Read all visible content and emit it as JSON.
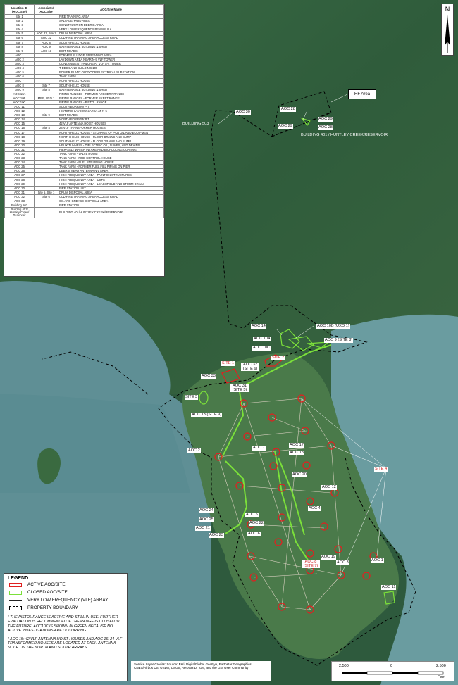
{
  "table": {
    "headers": [
      "Location ID (AOC/Site)",
      "Associated AOC/Site",
      "AOC/Site Name"
    ],
    "rows": [
      [
        "Site 1",
        "",
        "FIRE TRAINING AREA"
      ],
      [
        "Site 2",
        "",
        "SALVAGE YARD AREA"
      ],
      [
        "Site 3",
        "",
        "CONSTRUCTION DEBRIS AREA"
      ],
      [
        "Site 4",
        "",
        "VERY LOW FREQUENCY PENINSULA"
      ],
      [
        "Site 5",
        "AOC 31, Site 1",
        "DRUM DISPOSAL AREA"
      ],
      [
        "Site 6",
        "AOC 32",
        "OLD FIRE TRAINING AREA ACCESS ROAD"
      ],
      [
        "Site 7",
        "AOC 8",
        "SOUTH HELIX HOUSE"
      ],
      [
        "Site 8",
        "AOC 9",
        "MAINTENANCE BUILDING & SHED"
      ],
      [
        "Site 9",
        "AOC 13",
        "DIRT ROADS"
      ],
      [
        "AOC 1",
        "",
        "FORMER SLUDGE SPREADING AREA"
      ],
      [
        "AOC 2",
        "",
        "LAYDOWN AREA NEAR N-9 VLF TOWER"
      ],
      [
        "AOC 3",
        "",
        "CONTAINMENT FAILURE AT VLF S-4 TOWER"
      ],
      [
        "AOC 4",
        "",
        "T-DECK AND BUILDING 100"
      ],
      [
        "AOC 5",
        "",
        "POWER PLANT OUTDOOR ELECTRICAL SUBSTATION"
      ],
      [
        "AOC 6",
        "",
        "TANK FARM"
      ],
      [
        "AOC 7",
        "",
        "NORTH HELIX HOUSE"
      ],
      [
        "AOC 8",
        "Site 7",
        "SOUTH HELIX HOUSE"
      ],
      [
        "AOC 9",
        "Site 8",
        "MAINTENANCE BUILDING & SHED"
      ],
      [
        "AOC 10A",
        "",
        "FIRING RANGES - FORMER ARCHERY RANGE"
      ],
      [
        "AOC 10B",
        "MRP, UXO 1",
        "FIRING RANGES - FORMER SKEET RANGE"
      ],
      [
        "AOC 10C",
        "",
        "FIRING RANGES - PISTOL RANGE"
      ],
      [
        "AOC 11",
        "",
        "SOUTH BORROW PIT"
      ],
      [
        "AOC 12",
        "",
        "HISTORIC LAYDOWN AREA AT N-5"
      ],
      [
        "AOC 13",
        "Site 9",
        "DIRT ROADS"
      ],
      [
        "AOC 14",
        "",
        "NORTH BORROW PIT"
      ],
      [
        "AOC 15",
        "",
        "42 VLF ANTENNA HOIST HOUSES"
      ],
      [
        "AOC 16",
        "Site 4",
        "24 VLF TRANSFORMER HOUSES"
      ],
      [
        "AOC 17",
        "",
        "NORTH HELIX HOUSE - STORAGE OF PCB OIL AND EQUIPMENT"
      ],
      [
        "AOC 18",
        "",
        "NORTH HELIX HOUSE - FLOOR DRAINS AND SUMP"
      ],
      [
        "AOC 19",
        "",
        "SOUTH HELIX HOUSE - FLOOR DRAINS AND SUMP"
      ],
      [
        "AOC 20",
        "",
        "HELIX TUNNELS - DIELECTRIC OIL, SUMPS, AND DRAINS"
      ],
      [
        "AOC 21",
        "",
        "PIER-SALT WATER INTAKE AND BIOFOULING COATING"
      ],
      [
        "AOC 22",
        "",
        "TANK FARM - VALVE ROOM"
      ],
      [
        "AOC 23",
        "",
        "TANK FARM - FIRE CONTROL HOUSE"
      ],
      [
        "AOC 24",
        "",
        "TANK FARM - FUEL STRIPPING HOUSE"
      ],
      [
        "AOC 25",
        "",
        "TANK FARM - FORMER FUEL FILL PIPING ON PIER"
      ],
      [
        "AOC 26",
        "",
        "DEBRIS NEAR ANTENNA N-1 AREA"
      ],
      [
        "AOC 27",
        "",
        "HIGH FREQUENCY AREA - PAINT ON STRUCTURES"
      ],
      [
        "AOC 28",
        "",
        "HIGH FREQUENCY AREA - USTS"
      ],
      [
        "AOC 29",
        "",
        "HIGH FREQUENCY AREA - LEACHFIELD AND STORM DRAIN"
      ],
      [
        "AOC 30",
        "",
        "FIRE STATION UST"
      ],
      [
        "AOC 31",
        "Site 5, Site 1",
        "DRUM DISPOSAL AREA"
      ],
      [
        "AOC 32",
        "Site 6",
        "OLD FIRE TRAINING AREA ACCESS ROAD"
      ],
      [
        "AOC 33",
        "",
        "OIL AND GREASE DISPOSAL AREA"
      ],
      [
        "Building 503",
        "",
        "FIRE STATION"
      ],
      [
        "Building 401/ Huntley Creek/ Reservoir",
        "",
        "BUILDING 401/HUNTLEY CREEK/RESERVOIR"
      ]
    ]
  },
  "north_letter": "N",
  "legend": {
    "title": "LEGEND",
    "items": [
      {
        "label": "ACTIVE AOC/SITE",
        "symbol": "active",
        "color": "#e02020"
      },
      {
        "label": "CLOSED AOC/SITE",
        "symbol": "closed",
        "color": "#7be03a"
      },
      {
        "label": "VERY LOW FREQUENCY (VLF) ARRAY",
        "symbol": "line",
        "color": "#222222"
      },
      {
        "label": "PROPERTY BOUNDARY",
        "symbol": "dashed",
        "color": "#000000"
      }
    ],
    "note1": "¹ THE PISTOL RANGE IS ACTIVE AND STILL IN USE. FURTHER EVALUATION IS RECOMMENDED IF THE RANGE IS CLOSED IN THE FUTURE. AOC10C IS SHOWN IN GREEN BECAUSE NO ACTIVE INVESTIGATIONS ARE OCCURRING.",
    "note2": "² AOC 15: 42 VLF ANTENNA HOIST HOUSES AND AOC 16: 24 VLF TRANSFORMER HOUSES ARE LOCATED AT EACH ANTENNA NODE ON THE NORTH AND SOUTH ARRAYS."
  },
  "credits": "Service Layer Credits: Source: Esri, DigitalGlobe, GeoEye, Earthstar Geographics, CNES/Airbus DS, USDA, USGS, AeroGRID, IGN, and the GIS User Community",
  "scale": {
    "labels": [
      "2,500",
      "0",
      "2,500"
    ],
    "unit": "Feet"
  },
  "callouts": {
    "hf_area": "HF Area",
    "aoc30": "AOC 30",
    "building503": "BUILDING 503",
    "aoc28a": "AOC 28",
    "aoc29a": "AOC 29",
    "aoc29b": "AOC 29",
    "aoc28b": "AOC 28",
    "building401": "BUILDING 401 / HUNTLEY CREEK/RESERVOIR",
    "aoc14": "AOC 14",
    "aoc10b": "AOC 10B (UXO 1)",
    "aoc10a": "AOC 10A",
    "aoc9": "AOC 9 (SITE 8)",
    "aoc10c": "AOC 10C",
    "site2": "SITE 2",
    "site1": "SITE 1",
    "aoc32": "AOC 32 (SITE 6)",
    "aoc33": "AOC 33",
    "aoc31": "AOC 31 (SITE 5)",
    "site3": "SITE 3",
    "aoc13": "AOC 13 (SITE 9)",
    "aoc2": "AOC 2",
    "aoc7": "AOC 7",
    "aoc17": "AOC 17",
    "aoc18": "AOC 18",
    "aoc20": "AOC 20",
    "site4": "SITE 4",
    "aoc12": "AOC 12",
    "aoc4": "AOC 4",
    "aoc24": "AOC 24",
    "aoc25": "AOC 25",
    "aoc5": "AOC 5",
    "aoc22": "AOC 22",
    "aoc21": "AOC 21",
    "aoc23": "AOC 23",
    "aoc6": "AOC 6",
    "aoc19": "AOC 19",
    "aoc8": "AOC 8 (SITE 7)",
    "aoc3": "AOC 3",
    "aoc1": "AOC 1",
    "aoc11": "AOC 11"
  },
  "colors": {
    "active": "#e02020",
    "closed": "#7be03a",
    "water": "#5f8f95",
    "land": "#3e6b46"
  }
}
